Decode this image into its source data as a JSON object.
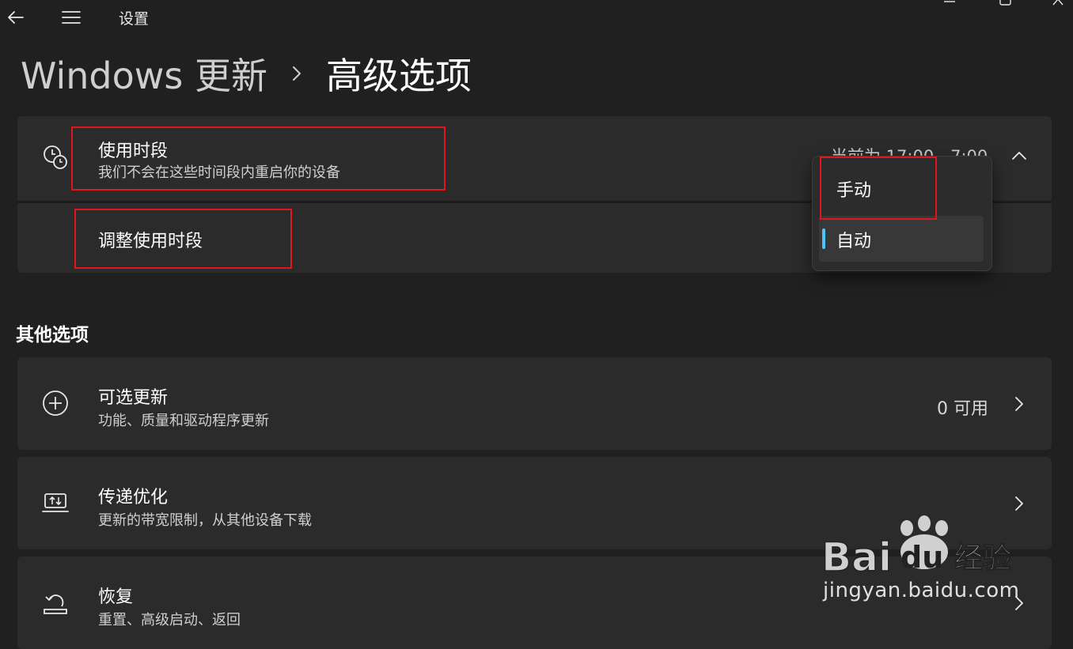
{
  "app": {
    "title": "设置"
  },
  "breadcrumb": {
    "parent": "Windows 更新",
    "current": "高级选项"
  },
  "active_hours": {
    "title": "使用时段",
    "description": "我们不会在这些时间段内重启你的设备",
    "current_value": "当前为 17:00 - 7:00",
    "adjust_label": "调整使用时段",
    "dropdown": {
      "options": [
        "手动",
        "自动"
      ],
      "selected": "自动"
    }
  },
  "other_options": {
    "heading": "其他选项",
    "items": [
      {
        "title": "可选更新",
        "description": "功能、质量和驱动程序更新",
        "badge": "0 可用",
        "icon": "plus-circle-icon"
      },
      {
        "title": "传递优化",
        "description": "更新的带宽限制，从其他设备下载",
        "badge": "",
        "icon": "delivery-optimization-icon"
      },
      {
        "title": "恢复",
        "description": "重置、高级启动、返回",
        "badge": "",
        "icon": "recovery-icon"
      }
    ]
  },
  "watermark": {
    "brand": "Bai du 经验",
    "url": "jingyan.baidu.com"
  },
  "colors": {
    "background": "#202020",
    "card": "#2b2b2b",
    "accent": "#4cc2ff",
    "highlight": "#e0161d"
  }
}
